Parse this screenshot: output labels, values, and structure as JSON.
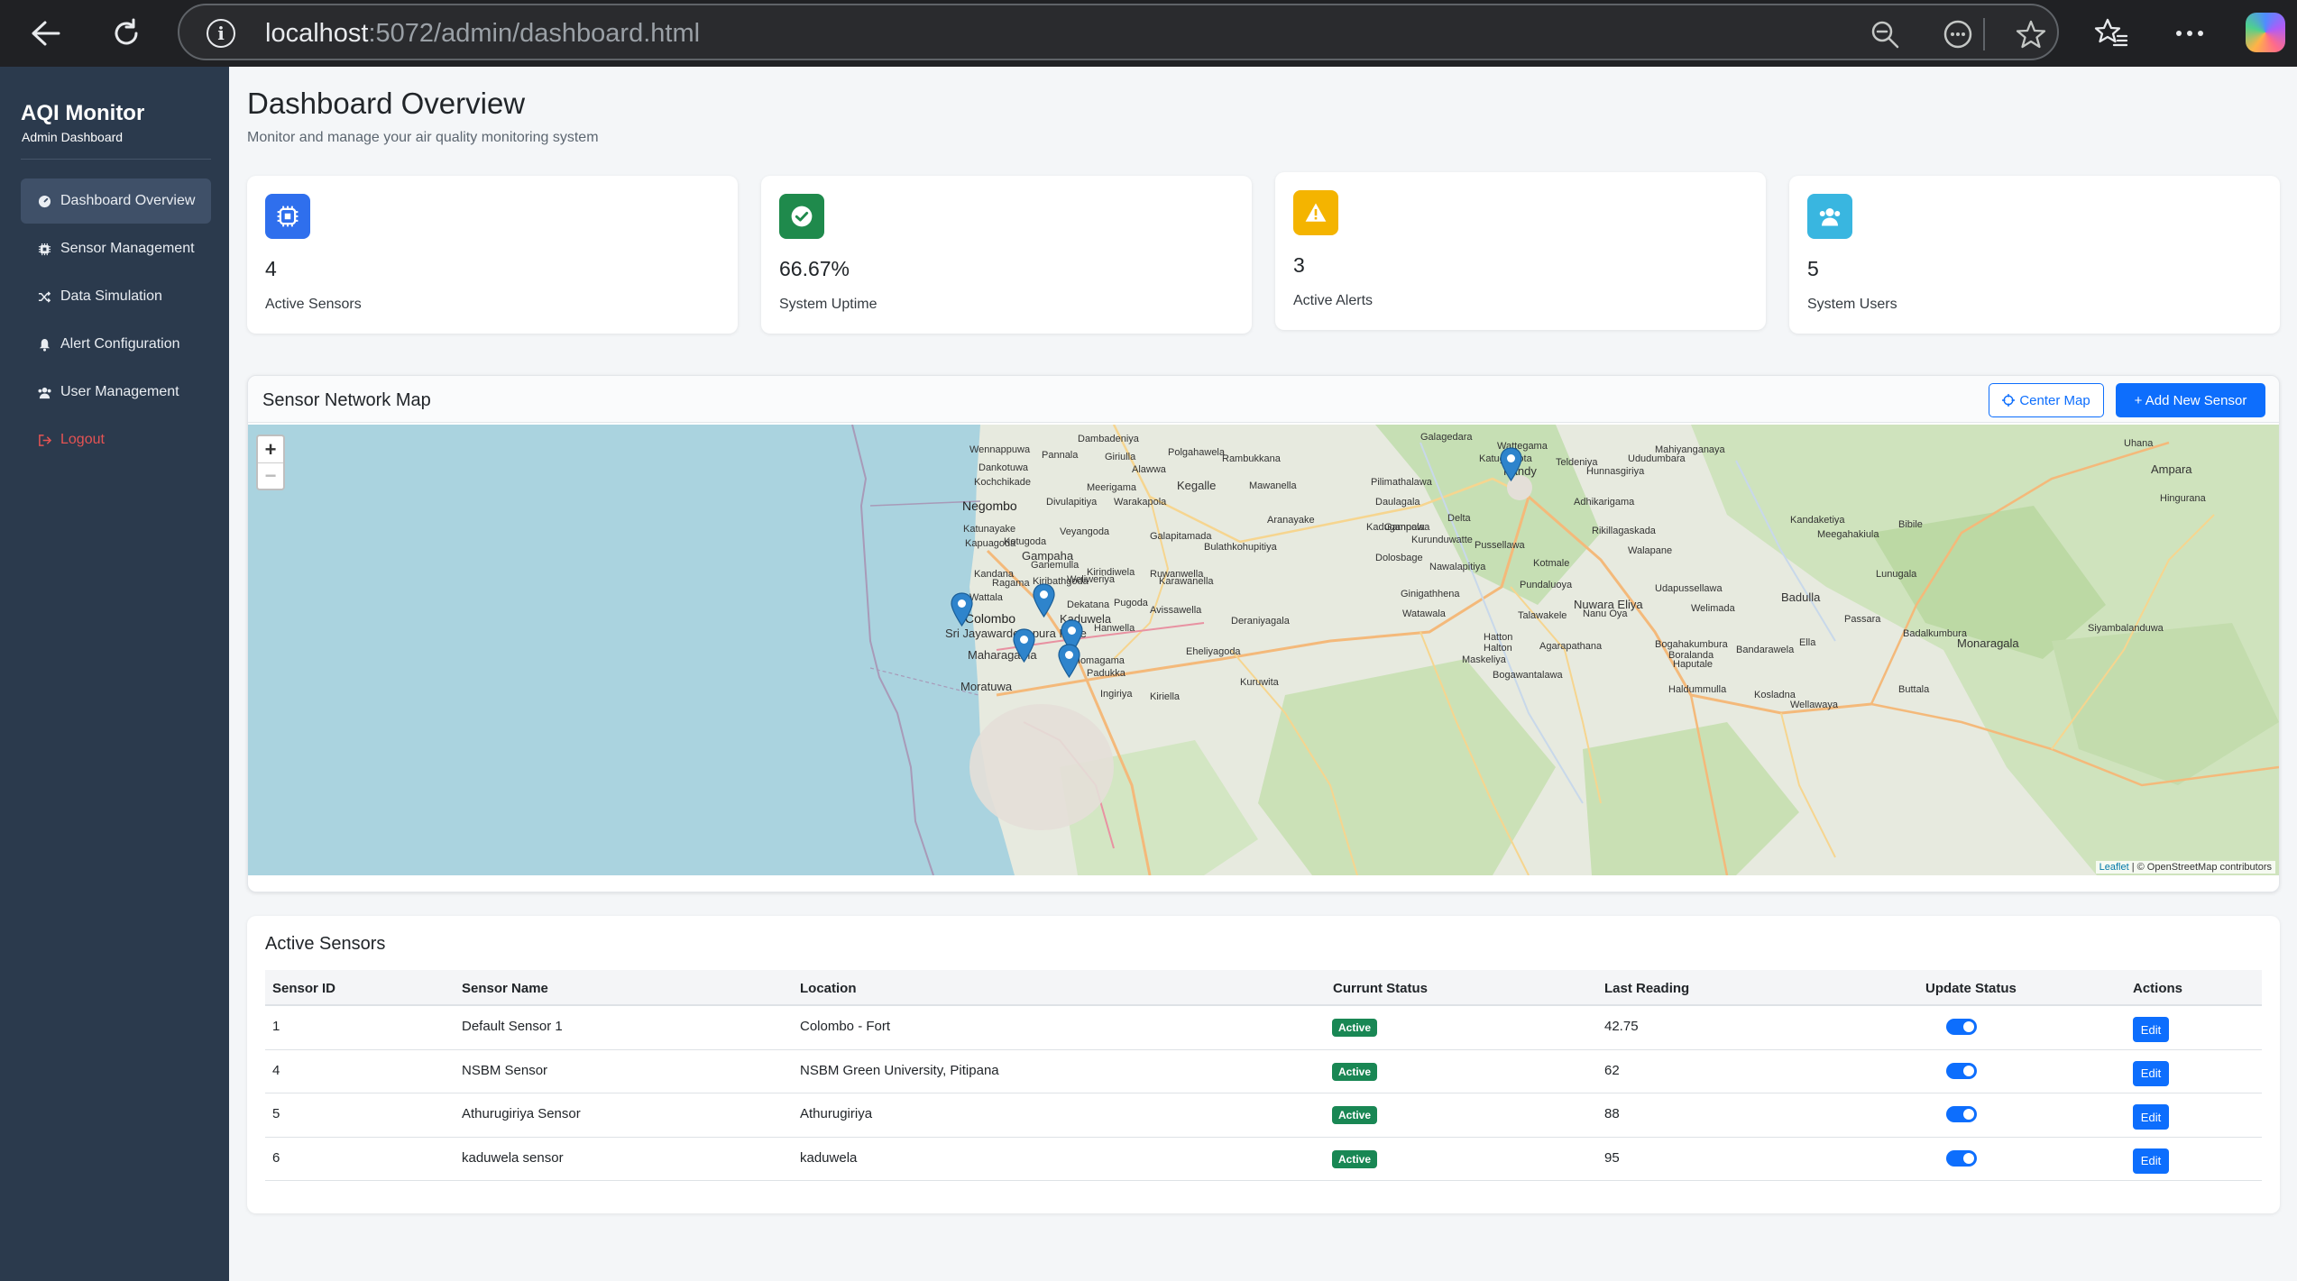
{
  "browser": {
    "url_host": "localhost",
    "url_rest": ":5072/admin/dashboard.html"
  },
  "sidebar": {
    "title": "AQI Monitor",
    "subtitle": "Admin Dashboard",
    "items": [
      {
        "label": "Dashboard Overview",
        "icon": "gauge-icon"
      },
      {
        "label": "Sensor Management",
        "icon": "cpu-icon"
      },
      {
        "label": "Data Simulation",
        "icon": "shuffle-icon"
      },
      {
        "label": "Alert Configuration",
        "icon": "bell-icon"
      },
      {
        "label": "User Management",
        "icon": "people-icon"
      },
      {
        "label": "Logout",
        "icon": "logout-icon"
      }
    ]
  },
  "header": {
    "title": "Dashboard Overview",
    "subtitle": "Monitor and manage your air quality monitoring system"
  },
  "stats": [
    {
      "value": "4",
      "label": "Active Sensors",
      "icon": "cpu-icon",
      "color": "#2f6fed"
    },
    {
      "value": "66.67%",
      "label": "System Uptime",
      "icon": "check-circle-icon",
      "color": "#1f8a4c"
    },
    {
      "value": "3",
      "label": "Active Alerts",
      "icon": "warning-icon",
      "color": "#f4b400"
    },
    {
      "value": "5",
      "label": "System Users",
      "icon": "people-icon",
      "color": "#39b6e0"
    }
  ],
  "map": {
    "title": "Sensor Network Map",
    "center_button": "Center Map",
    "add_button": "+ Add New Sensor",
    "zoom_in": "+",
    "zoom_out": "−",
    "attribution_leaflet": "Leaflet",
    "attribution_rest": " | © OpenStreetMap contributors",
    "places": [
      "Dambadeniya",
      "Wennappuwa",
      "Pannala",
      "Giriulla",
      "Polgahawela",
      "Rambukkana",
      "Galagedara",
      "Wattegama",
      "Mahiyanganaya",
      "Dankotuwa",
      "Kochchikade",
      "Negombo",
      "Meerigama",
      "Kegalle",
      "Mawanella",
      "Pilimathalawa",
      "Kandy",
      "Ududumbara",
      "Divulapitiya",
      "Warakapola",
      "Daulagala",
      "Hunnasgiriya",
      "Katunayake",
      "Veyangoda",
      "Aranayake",
      "Kapuagoda",
      "Kotugoda",
      "Gampaha",
      "Galapitamada",
      "Kadugannawa",
      "Gampola",
      "Ganemulla",
      "Kandana",
      "Ragama",
      "Kiribathgoda",
      "Weliweriya",
      "Ruwanwella",
      "Wattala",
      "Dekatana",
      "Pugoda",
      "Colombo",
      "Kaduwela",
      "Avissawella",
      "Sri Jayawardenepura Kotte",
      "Maharagama",
      "Homagama",
      "Moratuwa",
      "Eheliyagoda",
      "Hanwella",
      "Deraniyagala",
      "Nuwara Eliya",
      "Badulla",
      "Welimada",
      "Hatton",
      "Maskeliya",
      "Bogawantalawa",
      "Haldummulla",
      "Kosladna",
      "Wellawaya",
      "Buttala",
      "Monaragala",
      "Bibile",
      "Ampara",
      "Hingurana",
      "Uhana",
      "Passara",
      "Ella",
      "Bandarawela",
      "Haputale",
      "Lunugala",
      "Walapane",
      "Pundaluoya",
      "Kotmale",
      "Rikillagaskada",
      "Ingiriya",
      "Kiriella",
      "Kuruwita",
      "Nawalapitiya",
      "Ginigathhena",
      "Watawala",
      "Talawakele",
      "Nanu Oya",
      "Agarapathana",
      "Boralanda",
      "Bogahakumbura",
      "Kandaketiya",
      "Meegahakiula",
      "Siyambalanduwa",
      "Badalkumbura",
      "Udapussellawa",
      "Halton",
      "Dolosbage",
      "Kurunduwatte",
      "Bulathkohupitiya",
      "Karawanella",
      "Kirindiwela",
      "Alawwa",
      "Adhikarigama",
      "Delta",
      "Pussellawa",
      "Teldeniya",
      "Katugastota",
      "Padukka"
    ]
  },
  "sensors_table": {
    "title": "Active Sensors",
    "columns": [
      "Sensor ID",
      "Sensor Name",
      "Location",
      "Currunt Status",
      "Last Reading",
      "Update Status",
      "Actions"
    ],
    "rows": [
      {
        "id": "1",
        "name": "Default Sensor 1",
        "location": "Colombo - Fort",
        "status": "Active",
        "reading": "42.75",
        "action": "Edit"
      },
      {
        "id": "4",
        "name": "NSBM Sensor",
        "location": "NSBM Green University, Pitipana",
        "status": "Active",
        "reading": "62",
        "action": "Edit"
      },
      {
        "id": "5",
        "name": "Athurugiriya Sensor",
        "location": "Athurugiriya",
        "status": "Active",
        "reading": "88",
        "action": "Edit"
      },
      {
        "id": "6",
        "name": "kaduwela sensor",
        "location": "kaduwela",
        "status": "Active",
        "reading": "95",
        "action": "Edit"
      }
    ]
  }
}
